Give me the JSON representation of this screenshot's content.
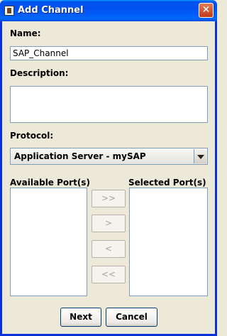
{
  "window": {
    "title": "Add Channel",
    "close_glyph": "✕",
    "icon": "app-icon"
  },
  "form": {
    "name_label": "Name:",
    "name_value": "SAP_Channel",
    "description_label": "Description:",
    "description_value": "",
    "protocol_label": "Protocol:",
    "protocol_value": "Application Server - mySAP"
  },
  "ports": {
    "available_label": "Available Port(s)",
    "selected_label": "Selected Port(s)",
    "add_all_label": ">>",
    "add_label": ">",
    "remove_label": "<",
    "remove_all_label": "<<"
  },
  "buttons": {
    "next_label": "Next",
    "cancel_label": "Cancel"
  }
}
